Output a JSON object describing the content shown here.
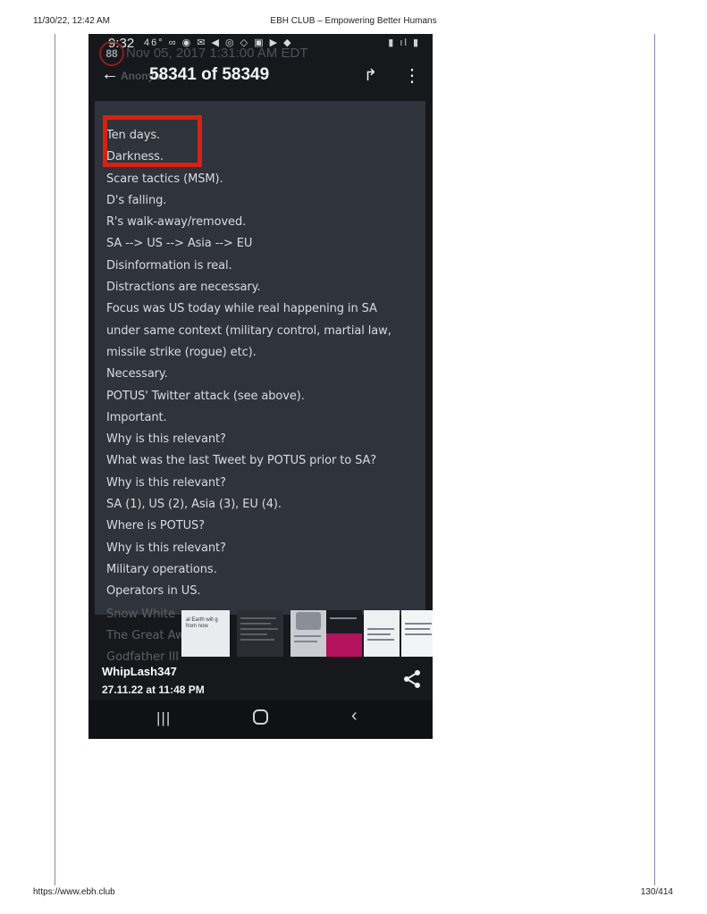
{
  "print": {
    "datetime": "11/30/22, 12:42 AM",
    "page_title": "EBH CLUB – Empowering Better Humans",
    "url": "https://www.ebh.club",
    "page_number": "130/414"
  },
  "phone": {
    "status_time": "9:32",
    "status_icons": "46° ∞ ◉ ✉ ◀ ◎ ◇ ▣ ▶ ◆",
    "status_right": "▮ ıl ▮",
    "ghost_badge": "88",
    "ghost_date": "Nov 05, 2017 1:31:00 AM EDT",
    "ghost_author": "Anonym",
    "back_icon": "←",
    "counter": "58341 of 58349",
    "share_forward_icon": "↱",
    "more_icon": "⋮",
    "post_lines": [
      "Ten days.",
      "Darkness.",
      "Scare tactics (MSM).",
      "D's falling.",
      "R's walk-away/removed.",
      "SA --> US --> Asia --> EU",
      "Disinformation is real.",
      "Distractions are necessary.",
      "Focus was US today while real happening in SA",
      "under same context (military control, martial law,",
      "missile strike (rogue) etc).",
      "Necessary.",
      "POTUS' Twitter attack (see above).",
      "Important.",
      "Why is this relevant?",
      "What was the last Tweet by POTUS prior to SA?",
      "Why is this relevant?",
      "SA (1), US (2), Asia (3), EU (4).",
      "Where is POTUS?",
      "Why is this relevant?",
      "Military operations.",
      "Operators in US."
    ],
    "faded_lines": [
      "Snow White",
      "The Great Aw",
      "Godfather III"
    ],
    "thumb_text": "al Earth will g from now",
    "author": "WhipLash347",
    "timestamp": "27.11.22 at 11:48 PM",
    "nav": {
      "recents": "|||",
      "back": "‹"
    },
    "colors": {
      "highlight": "#d62214",
      "post_bg": "#2f333b",
      "phone_bg": "#16181c"
    }
  }
}
